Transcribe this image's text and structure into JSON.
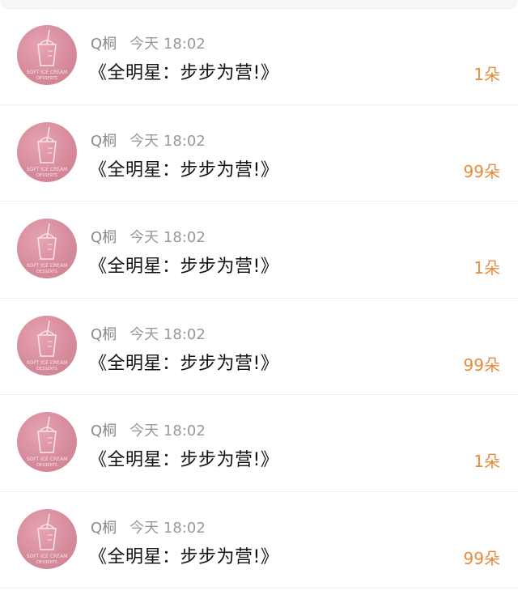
{
  "colors": {
    "accent_count": "#e58b3a",
    "meta_text": "#999999",
    "message_text": "#111111",
    "avatar_bg": "#d58a9a"
  },
  "avatar": {
    "icon": "ice-cream-cup-icon",
    "text_line1": "SOFT ICE CREAM",
    "text_line2": "DESSERTS"
  },
  "items": [
    {
      "name": "Q桐",
      "time": "今天 18:02",
      "message": "《全明星：步步为营!》",
      "count": "1朵"
    },
    {
      "name": "Q桐",
      "time": "今天 18:02",
      "message": "《全明星：步步为营!》",
      "count": "99朵"
    },
    {
      "name": "Q桐",
      "time": "今天 18:02",
      "message": "《全明星：步步为营!》",
      "count": "1朵"
    },
    {
      "name": "Q桐",
      "time": "今天 18:02",
      "message": "《全明星：步步为营!》",
      "count": "99朵"
    },
    {
      "name": "Q桐",
      "time": "今天 18:02",
      "message": "《全明星：步步为营!》",
      "count": "1朵"
    },
    {
      "name": "Q桐",
      "time": "今天 18:02",
      "message": "《全明星：步步为营!》",
      "count": "99朵"
    }
  ]
}
